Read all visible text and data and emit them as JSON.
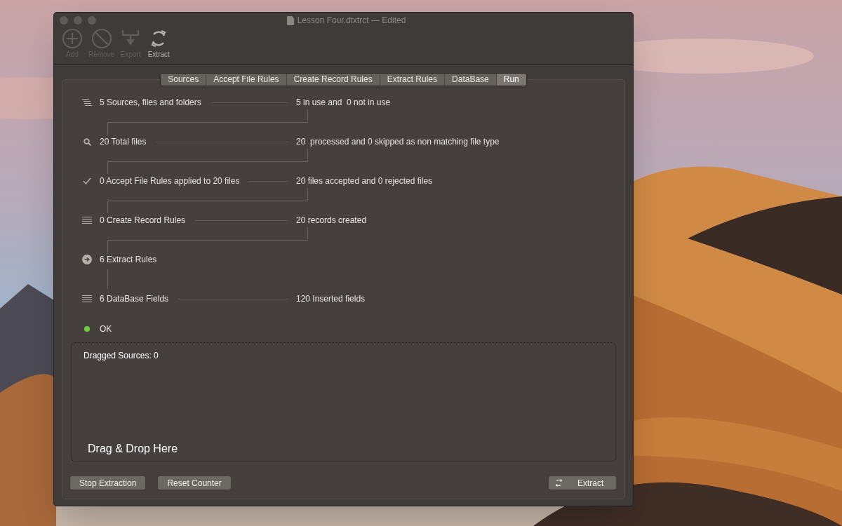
{
  "window": {
    "title": "Lesson Four.dtxtrct — Edited"
  },
  "toolbar": [
    {
      "kind": "add",
      "label": "Add",
      "disabled": true
    },
    {
      "kind": "remove",
      "label": "Remove",
      "disabled": true
    },
    {
      "kind": "export",
      "label": "Export",
      "disabled": true
    },
    {
      "kind": "extract",
      "label": "Extract",
      "disabled": false
    }
  ],
  "tabs": [
    {
      "label": "Sources",
      "selected": false
    },
    {
      "label": "Accept File Rules",
      "selected": false
    },
    {
      "label": "Create Record Rules",
      "selected": false
    },
    {
      "label": "Extract Rules",
      "selected": false
    },
    {
      "label": "DataBase",
      "selected": false
    },
    {
      "label": "Run",
      "selected": true
    }
  ],
  "steps": [
    {
      "kind": "list",
      "label": "5 Sources, files and folders",
      "result": "5 in use and  0 not in use",
      "connector": {
        "kind": "elbow"
      }
    },
    {
      "kind": "search",
      "label": "20 Total files",
      "result": "20  processed and 0 skipped as non matching file type",
      "connector": {
        "kind": "elbow"
      }
    },
    {
      "kind": "check",
      "label": "0 Accept File Rules applied to 20 files",
      "result": "20 files accepted and 0 rejected files",
      "connector": {
        "kind": "elbow"
      }
    },
    {
      "kind": "lines",
      "label": "0 Create Record Rules",
      "result": "20 records created",
      "connector": {
        "kind": "elbow"
      }
    },
    {
      "kind": "arrow",
      "label": "6 Extract Rules",
      "connector": {
        "kind": "straight"
      }
    },
    {
      "kind": "lines",
      "label": "6 DataBase Fields",
      "result": "120 Inserted fields"
    }
  ],
  "status": {
    "label": "OK",
    "color": "#6bd23c"
  },
  "drop_zone": {
    "counter": "Dragged Sources: 0",
    "hint": "Drag & Drop Here"
  },
  "buttons": [
    {
      "kind": "plain",
      "label": "Stop Extraction"
    },
    {
      "kind": "plain",
      "label": "Reset Counter"
    },
    {
      "kind": "extract",
      "label": "Extract"
    }
  ]
}
